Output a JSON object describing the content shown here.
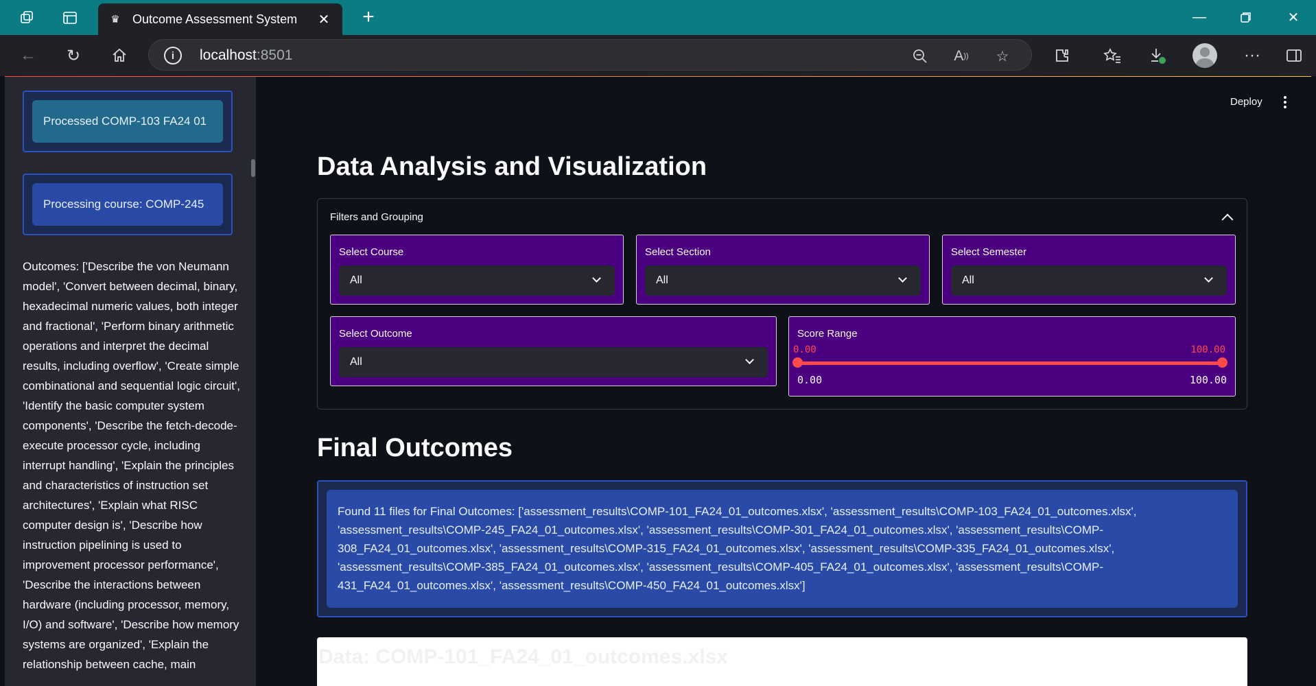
{
  "browser": {
    "tab_title": "Outcome Assessment System",
    "url_host": "localhost",
    "url_port": ":8501"
  },
  "sidebar": {
    "status_processed": "Processed COMP-103 FA24 01",
    "status_processing": "Processing course: COMP-245",
    "outcomes_text": "Outcomes: ['Describe the von Neumann model', 'Convert between decimal, binary, hexadecimal numeric values, both integer and fractional', 'Perform binary arithmetic operations and interpret the decimal results, including overflow', 'Create simple combinational and sequential logic circuit', 'Identify the basic computer system components', 'Describe the fetch-decode-execute processor cycle, including interrupt handling', 'Explain the principles and characteristics of instruction set architectures', 'Explain what RISC computer design is', 'Describe how instruction pipelining is used to improvement processor performance', 'Describe the interactions between hardware (including processor, memory, I/O) and software', 'Describe how memory systems are organized', 'Explain the relationship between cache, main"
  },
  "header": {
    "deploy_label": "Deploy"
  },
  "main": {
    "title": "Data Analysis and Visualization",
    "filters": {
      "title": "Filters and Grouping",
      "course_label": "Select Course",
      "course_value": "All",
      "section_label": "Select Section",
      "section_value": "All",
      "semester_label": "Select Semester",
      "semester_value": "All",
      "outcome_label": "Select Outcome",
      "outcome_value": "All",
      "score_label": "Score Range",
      "score_min": "0.00",
      "score_max": "100.00",
      "range_min_label": "0.00",
      "range_max_label": "100.00"
    },
    "final_title": "Final Outcomes",
    "final_info": "Found 11 files for Final Outcomes: ['assessment_results\\COMP-101_FA24_01_outcomes.xlsx', 'assessment_results\\COMP-103_FA24_01_outcomes.xlsx', 'assessment_results\\COMP-245_FA24_01_outcomes.xlsx', 'assessment_results\\COMP-301_FA24_01_outcomes.xlsx', 'assessment_results\\COMP-308_FA24_01_outcomes.xlsx', 'assessment_results\\COMP-315_FA24_01_outcomes.xlsx', 'assessment_results\\COMP-335_FA24_01_outcomes.xlsx', 'assessment_results\\COMP-385_FA24_01_outcomes.xlsx', 'assessment_results\\COMP-405_FA24_01_outcomes.xlsx', 'assessment_results\\COMP-431_FA24_01_outcomes.xlsx', 'assessment_results\\COMP-450_FA24_01_outcomes.xlsx']",
    "data_heading": "Data: COMP-101_FA24_01_outcomes.xlsx"
  },
  "colors": {
    "filter_bg": "#4b0082",
    "slider_accent": "#ff4b4b",
    "info_bg": "#2a4aa8",
    "tabbar_bg": "#0b7b84"
  }
}
